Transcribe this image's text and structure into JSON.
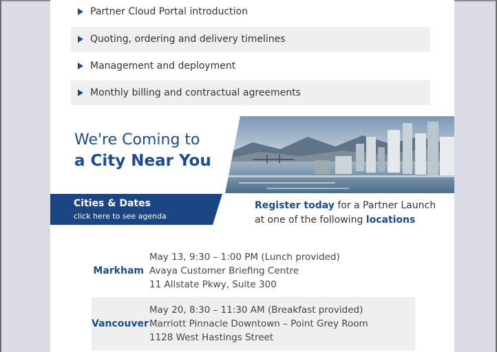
{
  "agenda": [
    {
      "label": "Partner Cloud Portal introduction"
    },
    {
      "label": "Quoting, ordering and delivery timelines"
    },
    {
      "label": "Management and deployment"
    },
    {
      "label": "Monthly billing and contractual agreements"
    }
  ],
  "hero": {
    "title_line1": "We're Coming to",
    "title_line2": "a City Near You"
  },
  "cities_band": {
    "title": "Cities & Dates",
    "subtitle": "click here to see agenda"
  },
  "register": {
    "strong": "Register today",
    "text1": " for a Partner Launch",
    "text2": "at one of the following ",
    "strong2": "locations"
  },
  "locations": [
    {
      "city": "Markham",
      "line1": "May 13, 9:30 – 1:00 PM (Lunch provided)",
      "line2": "Avaya Customer Briefing Centre",
      "line3": "11 Allstate Pkwy, Suite 300"
    },
    {
      "city": "Vancouver",
      "line1": "May 20, 8:30 – 11:30 AM (Breakfast provided)",
      "line2": "Marriott Pinnacle Downtown – Point Grey Room",
      "line3": "1128 West Hastings Street"
    }
  ],
  "colors": {
    "brand_blue": "#1a4c8f",
    "band_blue": "#1b4683",
    "row_gray": "#efefef",
    "page_side": "#dcdce6"
  }
}
